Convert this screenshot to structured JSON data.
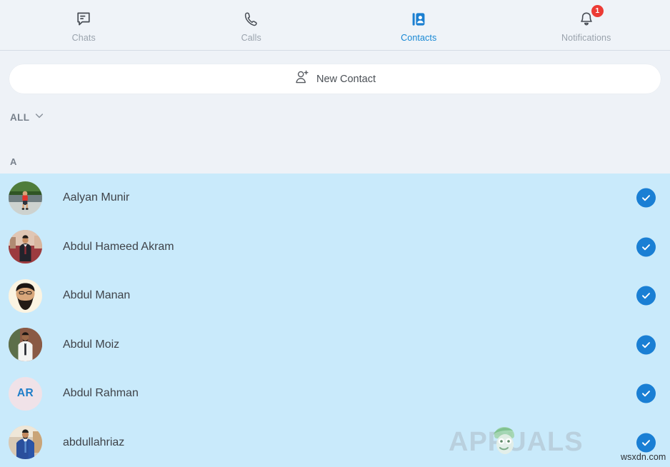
{
  "nav": {
    "items": [
      {
        "label": "Chats",
        "icon": "chat-bubble-icon",
        "active": false,
        "badge": null
      },
      {
        "label": "Calls",
        "icon": "phone-handset-icon",
        "active": false,
        "badge": null
      },
      {
        "label": "Contacts",
        "icon": "contact-book-icon",
        "active": true,
        "badge": null
      },
      {
        "label": "Notifications",
        "icon": "bell-icon",
        "active": false,
        "badge": "1"
      }
    ],
    "active_color": "#1687d4",
    "inactive_color": "#9aa3ad",
    "badge_color": "#ec3b35"
  },
  "new_contact": {
    "label": "New Contact",
    "icon": "person-plus-icon"
  },
  "filter": {
    "label": "ALL",
    "icon": "chevron-down-icon"
  },
  "section": {
    "letter": "A"
  },
  "contacts": [
    {
      "name": "Aalyan Munir",
      "avatar_type": "photo",
      "selected": true
    },
    {
      "name": "Abdul Hameed Akram",
      "avatar_type": "photo",
      "selected": true
    },
    {
      "name": "Abdul Manan",
      "avatar_type": "photo",
      "selected": true
    },
    {
      "name": "Abdul Moiz",
      "avatar_type": "photo",
      "selected": true
    },
    {
      "name": "Abdul Rahman",
      "avatar_type": "initials",
      "initials": "AR",
      "selected": true
    },
    {
      "name": "abdullahriaz",
      "avatar_type": "photo",
      "selected": true
    }
  ],
  "selection": {
    "row_background": "#c9eafb",
    "check_color": "#1a7fd4",
    "check_icon": "check-icon"
  },
  "watermark": {
    "brand": "APPUALS",
    "site": "wsxdn.com"
  }
}
